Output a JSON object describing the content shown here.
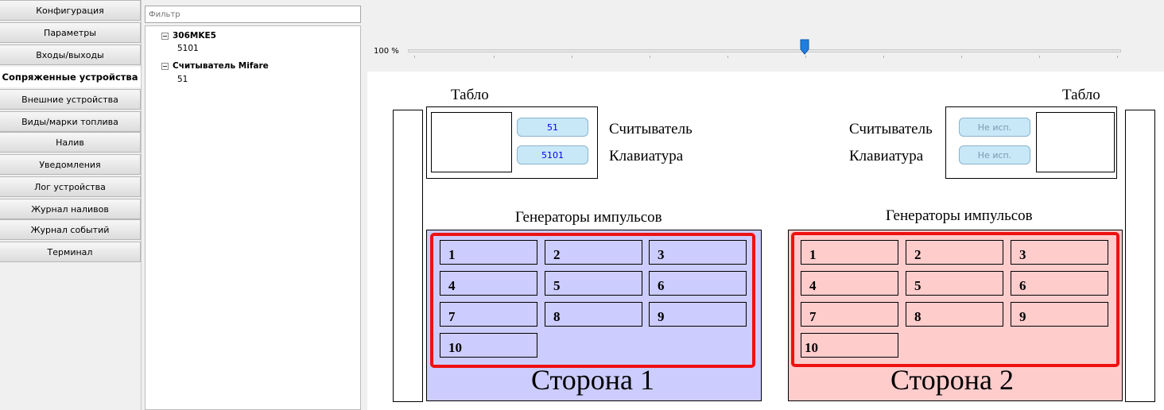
{
  "nav": {
    "items": [
      {
        "label": "Конфигурация"
      },
      {
        "label": "Параметры"
      },
      {
        "label": "Входы/выходы"
      },
      {
        "label": "Сопряженные устройства",
        "active": true
      },
      {
        "label": "Внешние устройства"
      },
      {
        "label": "Виды/марки топлива"
      },
      {
        "label": "Налив"
      },
      {
        "label": "Уведомления"
      },
      {
        "label": "Лог устройства"
      },
      {
        "label": "Журнал наливов"
      },
      {
        "label": "Журнал событий"
      },
      {
        "label": "Терминал"
      }
    ]
  },
  "filter": {
    "placeholder": "Фильтр"
  },
  "tree": {
    "nodes": [
      {
        "label": "306MKE5",
        "child": "5101"
      },
      {
        "label": "Считыватель Mifare",
        "child": "51"
      }
    ]
  },
  "zoom": {
    "label": "100 %",
    "position": 0.55
  },
  "scheme": {
    "left": {
      "tablo": "Табло",
      "reader_label": "Считыватель",
      "reader_value": "51",
      "keyboard_label": "Клавиатура",
      "keyboard_value": "5101",
      "generators_title": "Генераторы импульсов",
      "cells": [
        "1",
        "2",
        "3",
        "4",
        "5",
        "6",
        "7",
        "8",
        "9",
        "10"
      ],
      "side_label": "Сторона 1",
      "color": "#ccccff"
    },
    "right": {
      "tablo": "Табло",
      "reader_label": "Считыватель",
      "reader_value": "Не исп.",
      "keyboard_label": "Клавиатура",
      "keyboard_value": "Не исп.",
      "generators_title": "Генераторы импульсов",
      "cells": [
        "1",
        "2",
        "3",
        "4",
        "5",
        "6",
        "7",
        "8",
        "9",
        "10"
      ],
      "side_label": "Сторона 2",
      "color": "#ffcccc"
    },
    "accent": "#ee1111"
  }
}
